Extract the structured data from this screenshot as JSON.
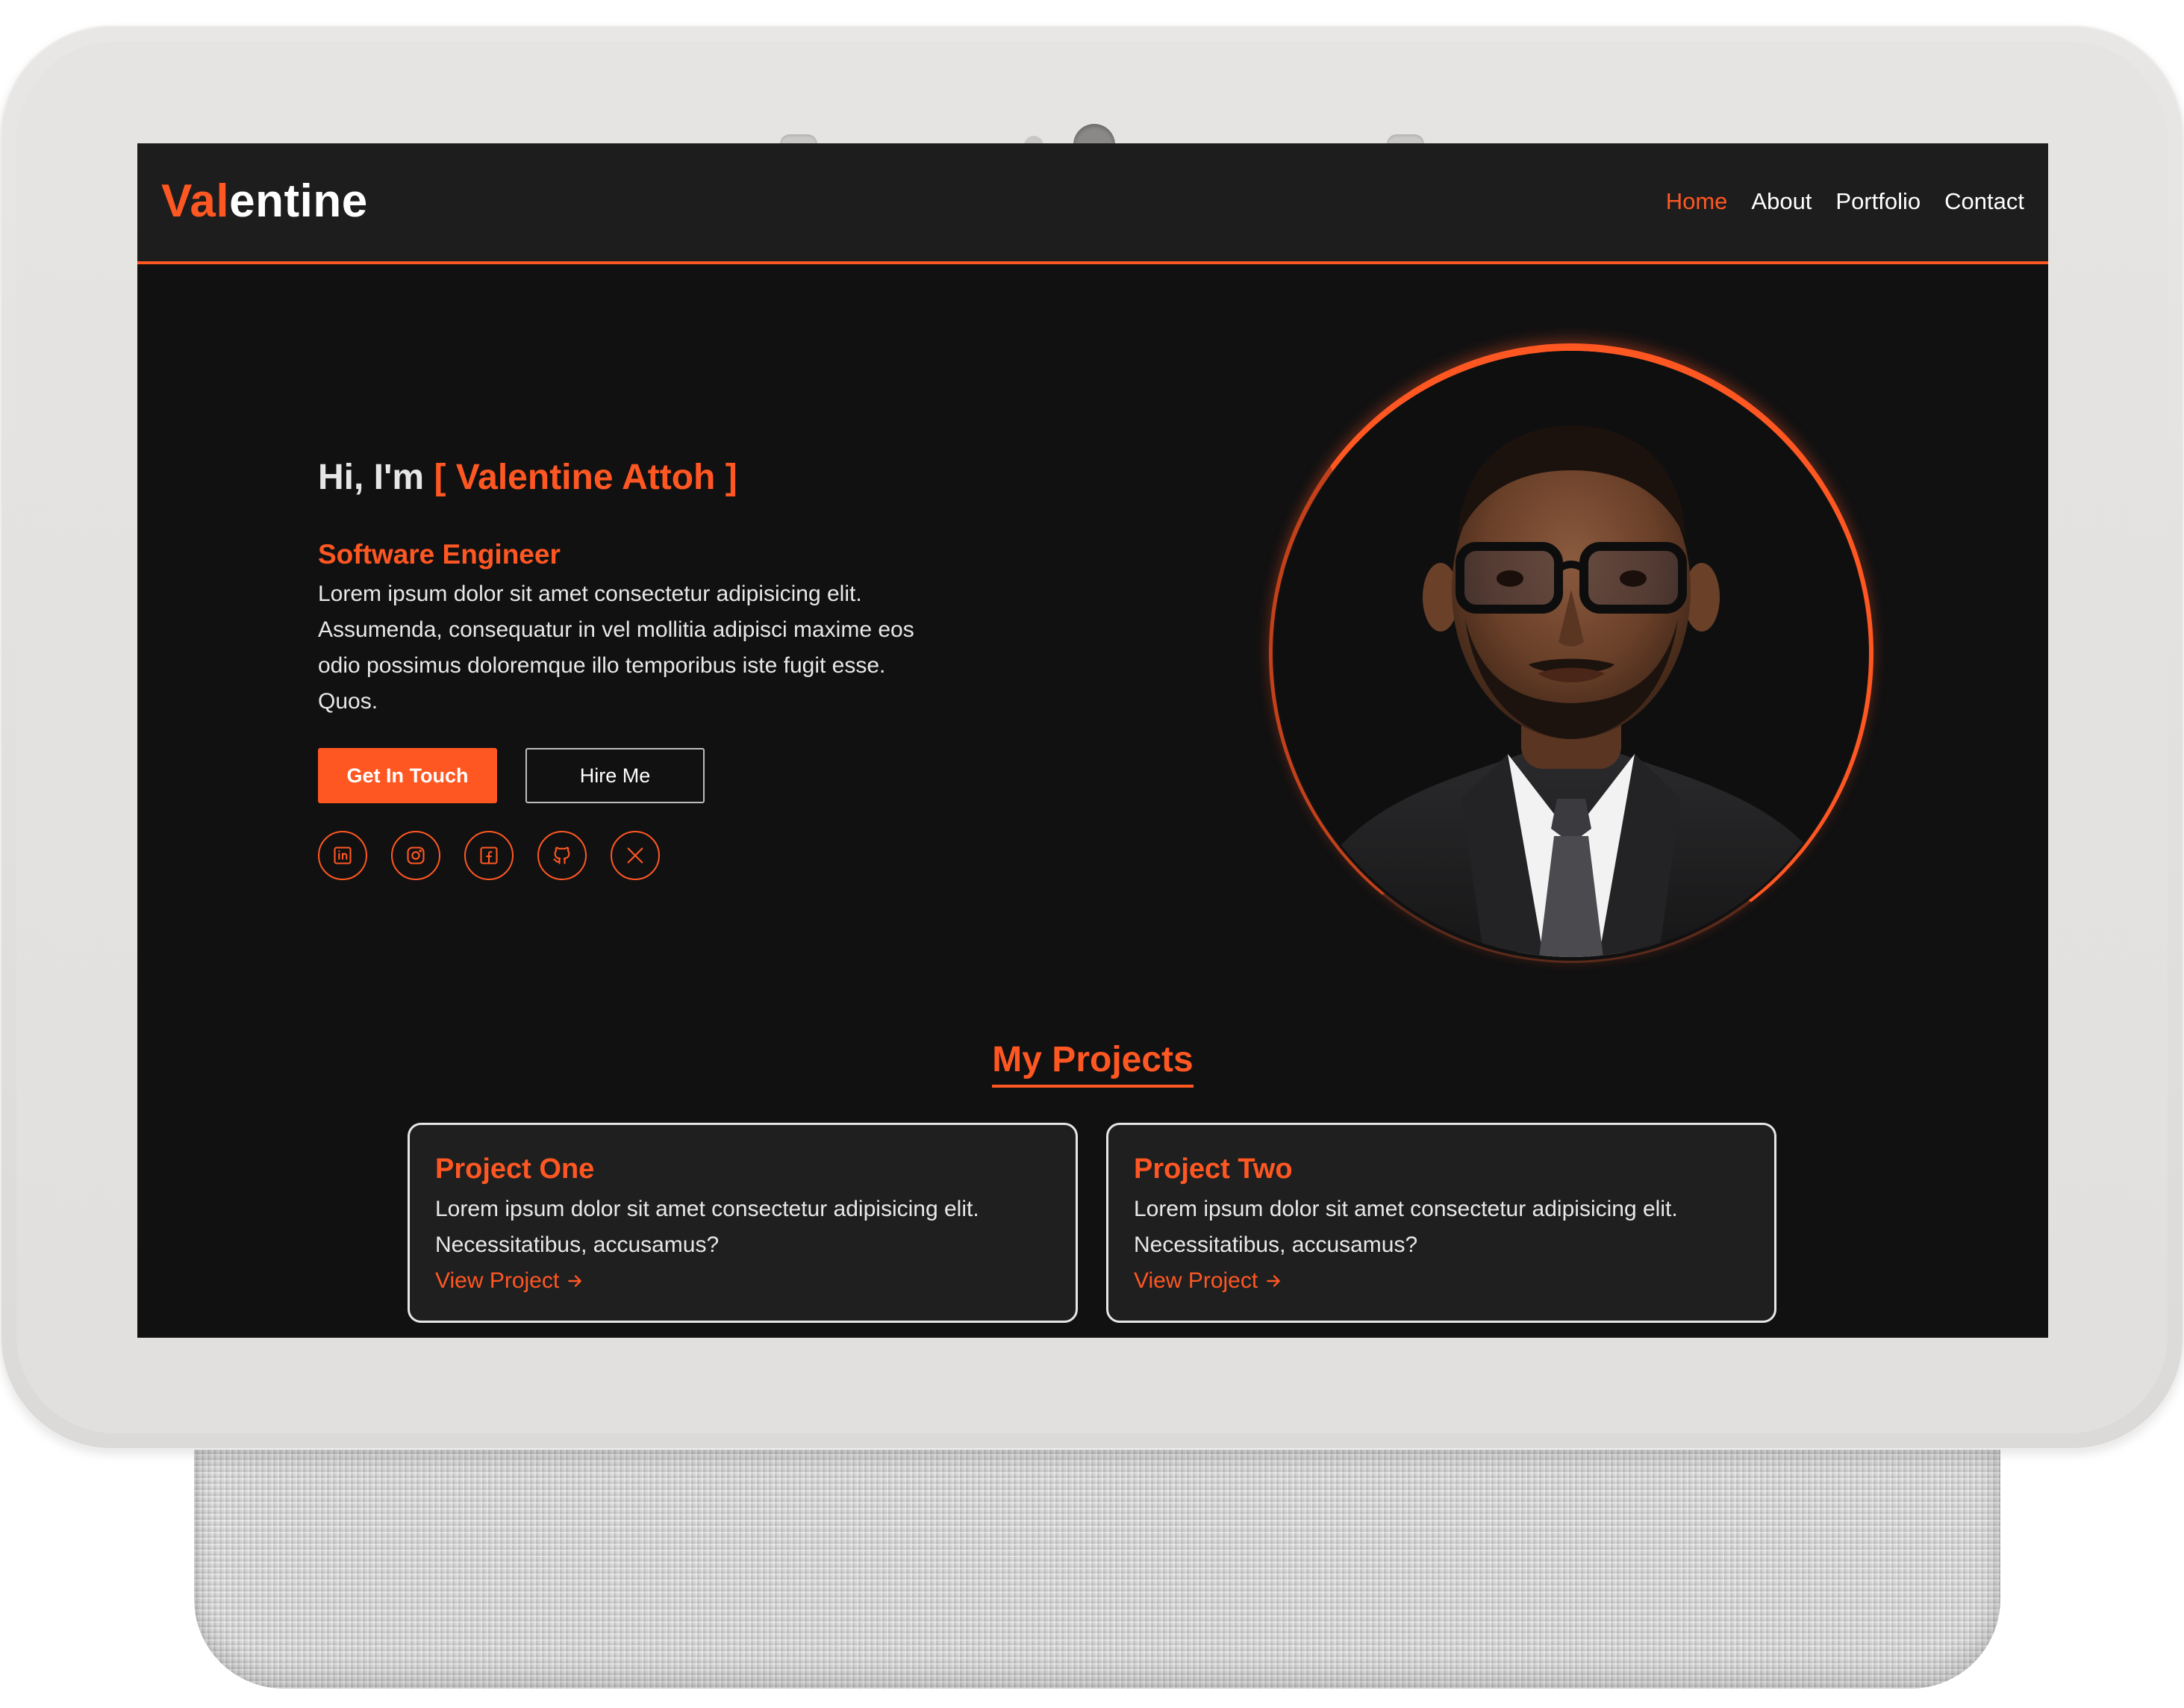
{
  "nav": {
    "logo_accent": "Val",
    "logo_rest": "entine",
    "links": [
      "Home",
      "About",
      "Portfolio",
      "Contact"
    ],
    "active_link": "Home"
  },
  "hero": {
    "greeting_prefix": "Hi, I'm",
    "name": "[ Valentine Attoh ]",
    "role": "Software Engineer",
    "description": "Lorem ipsum dolor sit amet consectetur adipisicing elit. Assumenda, consequatur in vel mollitia adipisci maxime eos odio possimus doloremque illo temporibus iste fugit esse. Quos.",
    "primary_button": "Get In Touch",
    "secondary_button": "Hire Me",
    "socials": [
      "linkedin-icon",
      "instagram-icon",
      "facebook-icon",
      "github-icon",
      "x-icon"
    ]
  },
  "projects": {
    "title": "My Projects",
    "items": [
      {
        "title": "Project One",
        "description": "Lorem ipsum dolor sit amet consectetur adipisicing elit. Necessitatibus, accusamus?",
        "link": "View Project"
      },
      {
        "title": "Project Two",
        "description": "Lorem ipsum dolor sit amet consectetur adipisicing elit. Necessitatibus, accusamus?",
        "link": "View Project"
      }
    ]
  },
  "colors": {
    "accent": "#ff5722",
    "background": "#111112",
    "nav_background": "#1d1d1e",
    "card_background": "#1f1f20"
  }
}
